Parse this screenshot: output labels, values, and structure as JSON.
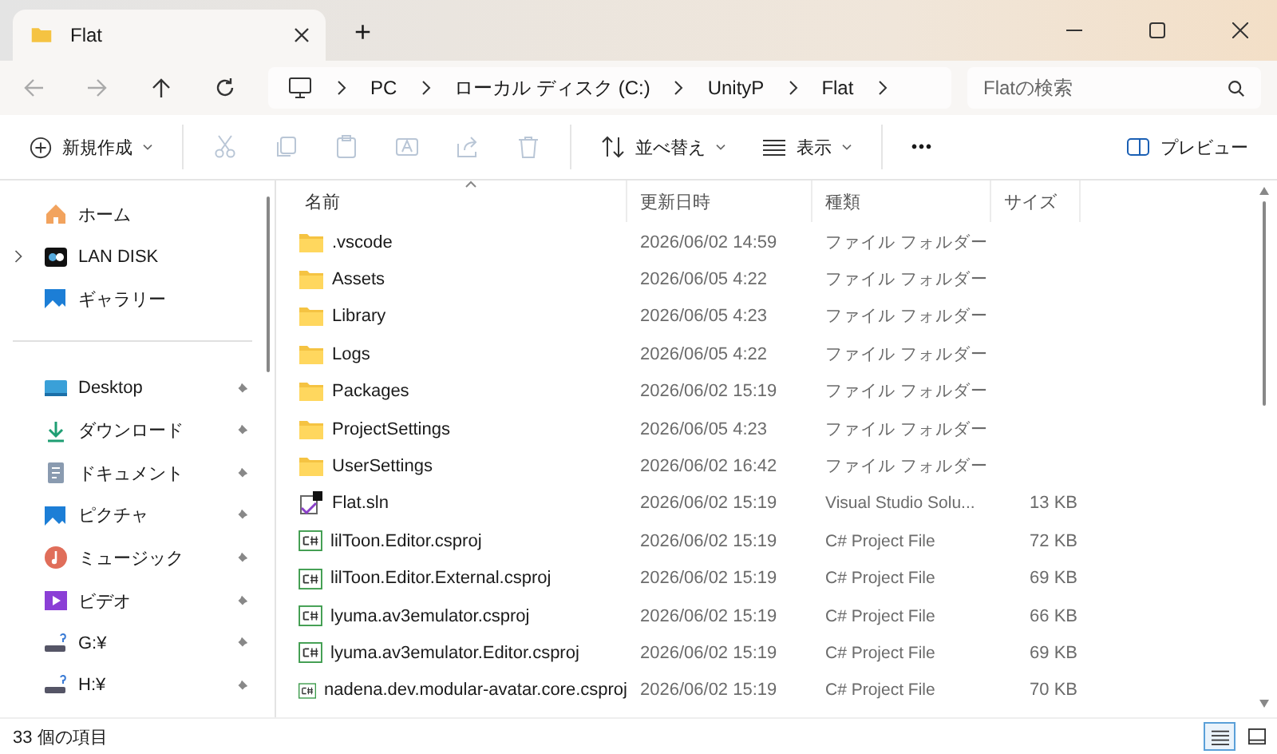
{
  "window": {
    "tab_title": "Flat",
    "new_tab": "+"
  },
  "address_bar": {
    "breadcrumbs": [
      "PC",
      "ローカル ディスク (C:)",
      "UnityP",
      "Flat"
    ],
    "search": {
      "placeholder": "Flatの検索"
    }
  },
  "toolbar": [
    {
      "kind": "new",
      "label": "新規作成",
      "disabled": false
    },
    {
      "kind": "cut",
      "disabled": true
    },
    {
      "kind": "copy",
      "disabled": true
    },
    {
      "kind": "paste",
      "disabled": true
    },
    {
      "kind": "rename",
      "disabled": true
    },
    {
      "kind": "share",
      "disabled": true
    },
    {
      "kind": "delete",
      "disabled": true
    },
    {
      "kind": "sort",
      "label": "並べ替え",
      "disabled": false
    },
    {
      "kind": "view",
      "label": "表示",
      "disabled": false
    },
    {
      "kind": "more",
      "label": "•••",
      "disabled": false
    },
    {
      "kind": "preview",
      "label": "プレビュー",
      "disabled": false
    }
  ],
  "sidebar": {
    "top": [
      {
        "kind": "home",
        "label": "ホーム",
        "expandable": false
      },
      {
        "kind": "nas",
        "label": "LAN DISK",
        "expandable": true
      },
      {
        "kind": "gallery",
        "label": "ギャラリー",
        "expandable": false
      }
    ],
    "quick": [
      {
        "kind": "desktop",
        "label": "Desktop",
        "pinned": true
      },
      {
        "kind": "download",
        "label": "ダウンロード",
        "pinned": true
      },
      {
        "kind": "documents",
        "label": "ドキュメント",
        "pinned": true
      },
      {
        "kind": "pictures",
        "label": "ピクチャ",
        "pinned": true
      },
      {
        "kind": "music",
        "label": "ミュージック",
        "pinned": true
      },
      {
        "kind": "video",
        "label": "ビデオ",
        "pinned": true
      },
      {
        "kind": "drive",
        "label": "G:¥",
        "pinned": true
      },
      {
        "kind": "drive",
        "label": "H:¥",
        "pinned": true
      }
    ]
  },
  "table": {
    "columns": [
      {
        "label": "名前",
        "sorted": true
      },
      {
        "label": "更新日時",
        "sorted": false
      },
      {
        "label": "種類",
        "sorted": false
      },
      {
        "label": "サイズ",
        "sorted": false
      }
    ],
    "rows": [
      {
        "kind": "folder",
        "name": ".vscode",
        "modified": "2026/06/02 14:59",
        "type": "ファイル フォルダー"
      },
      {
        "kind": "folder",
        "name": "Assets",
        "modified": "2026/06/05 4:22",
        "type": "ファイル フォルダー"
      },
      {
        "kind": "folder",
        "name": "Library",
        "modified": "2026/06/05 4:23",
        "type": "ファイル フォルダー"
      },
      {
        "kind": "folder",
        "name": "Logs",
        "modified": "2026/06/05 4:22",
        "type": "ファイル フォルダー"
      },
      {
        "kind": "folder",
        "name": "Packages",
        "modified": "2026/06/02 15:19",
        "type": "ファイル フォルダー"
      },
      {
        "kind": "folder",
        "name": "ProjectSettings",
        "modified": "2026/06/05 4:23",
        "type": "ファイル フォルダー"
      },
      {
        "kind": "folder",
        "name": "UserSettings",
        "modified": "2026/06/02 16:42",
        "type": "ファイル フォルダー"
      },
      {
        "kind": "sln",
        "name": "Flat.sln",
        "modified": "2026/06/02 15:19",
        "type": "Visual Studio Solu...",
        "size": "13 KB"
      },
      {
        "kind": "csproj",
        "name": "lilToon.Editor.csproj",
        "modified": "2026/06/02 15:19",
        "type": "C# Project File",
        "size": "72 KB"
      },
      {
        "kind": "csproj",
        "name": "lilToon.Editor.External.csproj",
        "modified": "2026/06/02 15:19",
        "type": "C# Project File",
        "size": "69 KB"
      },
      {
        "kind": "csproj",
        "name": "lyuma.av3emulator.csproj",
        "modified": "2026/06/02 15:19",
        "type": "C# Project File",
        "size": "66 KB"
      },
      {
        "kind": "csproj",
        "name": "lyuma.av3emulator.Editor.csproj",
        "modified": "2026/06/02 15:19",
        "type": "C# Project File",
        "size": "69 KB"
      },
      {
        "kind": "csproj",
        "name": "nadena.dev.modular-avatar.core.csproj",
        "modified": "2026/06/02 15:19",
        "type": "C# Project File",
        "size": "70 KB"
      }
    ]
  },
  "status_bar": {
    "count": "33 個の項目",
    "view_buttons": [
      {
        "kind": "details",
        "selected": true
      },
      {
        "kind": "tiles",
        "selected": false
      }
    ]
  }
}
